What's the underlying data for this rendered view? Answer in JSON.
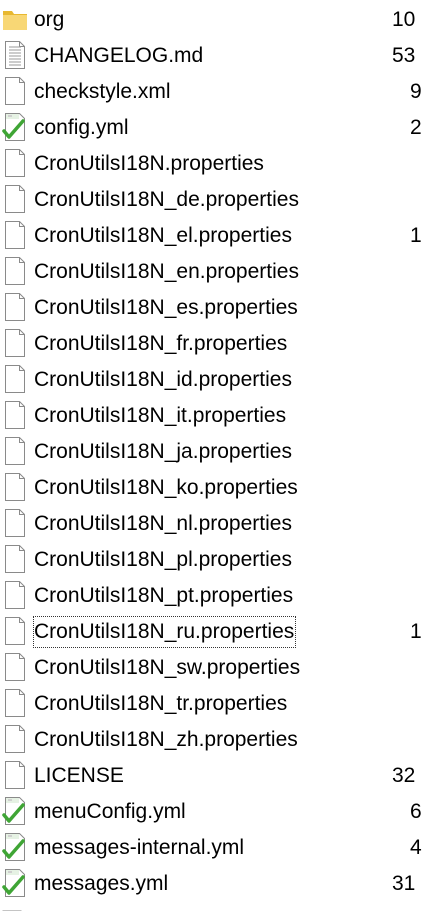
{
  "explorer": {
    "rows": [
      {
        "name": "org",
        "size": "10",
        "icon": "folder-icon",
        "type": "folder"
      },
      {
        "name": "CHANGELOG.md",
        "size": "53",
        "icon": "text-document-icon",
        "type": "text"
      },
      {
        "name": "checkstyle.xml",
        "size": "9",
        "icon": "blank-file-icon",
        "type": "blank"
      },
      {
        "name": "config.yml",
        "size": "2",
        "icon": "yaml-file-icon",
        "type": "yaml"
      },
      {
        "name": "CronUtilsI18N.properties",
        "size": "",
        "icon": "blank-file-icon",
        "type": "blank"
      },
      {
        "name": "CronUtilsI18N_de.properties",
        "size": "",
        "icon": "blank-file-icon",
        "type": "blank"
      },
      {
        "name": "CronUtilsI18N_el.properties",
        "size": "1",
        "icon": "blank-file-icon",
        "type": "blank"
      },
      {
        "name": "CronUtilsI18N_en.properties",
        "size": "",
        "icon": "blank-file-icon",
        "type": "blank"
      },
      {
        "name": "CronUtilsI18N_es.properties",
        "size": "",
        "icon": "blank-file-icon",
        "type": "blank"
      },
      {
        "name": "CronUtilsI18N_fr.properties",
        "size": "",
        "icon": "blank-file-icon",
        "type": "blank"
      },
      {
        "name": "CronUtilsI18N_id.properties",
        "size": "",
        "icon": "blank-file-icon",
        "type": "blank"
      },
      {
        "name": "CronUtilsI18N_it.properties",
        "size": "",
        "icon": "blank-file-icon",
        "type": "blank"
      },
      {
        "name": "CronUtilsI18N_ja.properties",
        "size": "",
        "icon": "blank-file-icon",
        "type": "blank"
      },
      {
        "name": "CronUtilsI18N_ko.properties",
        "size": "",
        "icon": "blank-file-icon",
        "type": "blank"
      },
      {
        "name": "CronUtilsI18N_nl.properties",
        "size": "",
        "icon": "blank-file-icon",
        "type": "blank"
      },
      {
        "name": "CronUtilsI18N_pl.properties",
        "size": "",
        "icon": "blank-file-icon",
        "type": "blank"
      },
      {
        "name": "CronUtilsI18N_pt.properties",
        "size": "",
        "icon": "blank-file-icon",
        "type": "blank"
      },
      {
        "name": "CronUtilsI18N_ru.properties",
        "size": "1",
        "icon": "blank-file-icon",
        "type": "blank",
        "focused": true
      },
      {
        "name": "CronUtilsI18N_sw.properties",
        "size": "",
        "icon": "blank-file-icon",
        "type": "blank"
      },
      {
        "name": "CronUtilsI18N_tr.properties",
        "size": "",
        "icon": "blank-file-icon",
        "type": "blank"
      },
      {
        "name": "CronUtilsI18N_zh.properties",
        "size": "",
        "icon": "blank-file-icon",
        "type": "blank"
      },
      {
        "name": "LICENSE",
        "size": "32",
        "icon": "blank-file-icon",
        "type": "blank"
      },
      {
        "name": "menuConfig.yml",
        "size": "6",
        "icon": "yaml-file-icon",
        "type": "yaml"
      },
      {
        "name": "messages-internal.yml",
        "size": "4",
        "icon": "yaml-file-icon",
        "type": "yaml"
      },
      {
        "name": "messages.yml",
        "size": "31",
        "icon": "yaml-file-icon",
        "type": "yaml"
      }
    ],
    "colors": {
      "folder": "#f8d775",
      "folder_dark": "#e8b830",
      "yaml_check": "#3fa535",
      "file_border": "#8a8a8a"
    }
  }
}
